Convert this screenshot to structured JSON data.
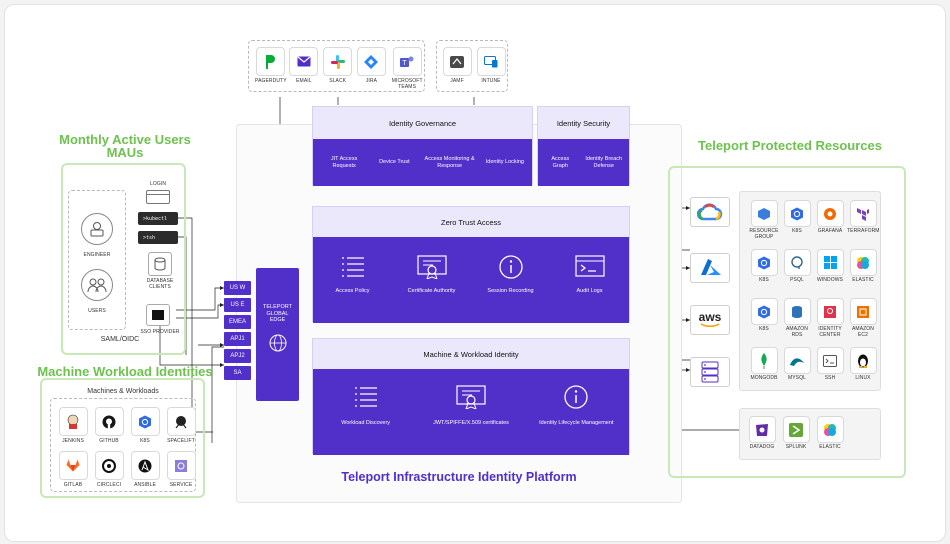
{
  "integrations": {
    "left_items": [
      {
        "label": "PAGERDUTY",
        "icon": "pagerduty-icon"
      },
      {
        "label": "EMAIL",
        "icon": "email-icon"
      },
      {
        "label": "SLACK",
        "icon": "slack-icon"
      },
      {
        "label": "JIRA",
        "icon": "jira-icon"
      },
      {
        "label": "MICROSOFT TEAMS",
        "icon": "microsoft-teams-icon"
      }
    ],
    "right_items": [
      {
        "label": "JAMF",
        "icon": "jamf-icon"
      },
      {
        "label": "INTUNE",
        "icon": "intune-icon"
      }
    ]
  },
  "governance": {
    "title": "Identity Governance",
    "items": [
      "JIT Access Requests",
      "Device Trust",
      "Access Monitoring & Response",
      "Identity Locking"
    ]
  },
  "security": {
    "title": "Identity Security",
    "items": [
      "Access Graph",
      "Identity Breach Defense"
    ]
  },
  "zero_trust": {
    "title": "Zero Trust Access",
    "items": [
      "Access Policy",
      "Certificate Authority",
      "Session Recording",
      "Audit Logs"
    ]
  },
  "machine_identity": {
    "title": "Machine & Workload Identity",
    "items": [
      "Workload Discovery",
      "JWT/SPIFFE/X.509 certificates",
      "Identity Lifecycle Management"
    ]
  },
  "platform_title": "Teleport Infrastructure Identity Platform",
  "edge": {
    "label": "TELEPORT GLOBAL EDGE"
  },
  "regions": [
    "US W",
    "US E",
    "EMEA",
    "APJ1",
    "APJ2",
    "SA"
  ],
  "mau": {
    "title_line1": "Monthly Active Users",
    "title_line2": "MAUs",
    "engineer": "ENGINEER",
    "users": "USERS",
    "login": "LOGIN",
    "kubectl": ">kubectl",
    "tsh": ">tsh",
    "db_clients": "DATABASE CLIENTS",
    "sso": "SSO PROVIDER",
    "saml": "SAML/OIDC"
  },
  "machine_workload": {
    "title": "Machine Workload Identities",
    "box_title": "Machines & Workloads",
    "items": [
      "JENKINS",
      "GITHUB",
      "K8S",
      "SPACELIFT",
      "GITLAB",
      "CIRCLECI",
      "ANSIBLE",
      "SERVICE"
    ]
  },
  "protected": {
    "title": "Teleport Protected Resources",
    "clouds": [
      "google-cloud-icon",
      "azure-icon",
      "aws-icon",
      "server-icon"
    ],
    "aws_label": "aws",
    "resources": [
      "RESOURCE GROUP",
      "K8S",
      "GRAFANA",
      "TERRAFORM",
      "K8S",
      "PSQL",
      "WINDOWS",
      "ELASTIC",
      "K8S",
      "AMAZON RDS",
      "IDENTITY CENTER",
      "AMAZON EC2",
      "MONGODB",
      "MYSQL",
      "SSH",
      "LINUX"
    ],
    "tools": [
      "DATADOG",
      "SPLUNK",
      "ELASTIC"
    ]
  },
  "colors": {
    "purple": "#512fc9",
    "lavender": "#ebe8fb",
    "green": "#6ec24f",
    "green_border": "#c9e8b7"
  }
}
